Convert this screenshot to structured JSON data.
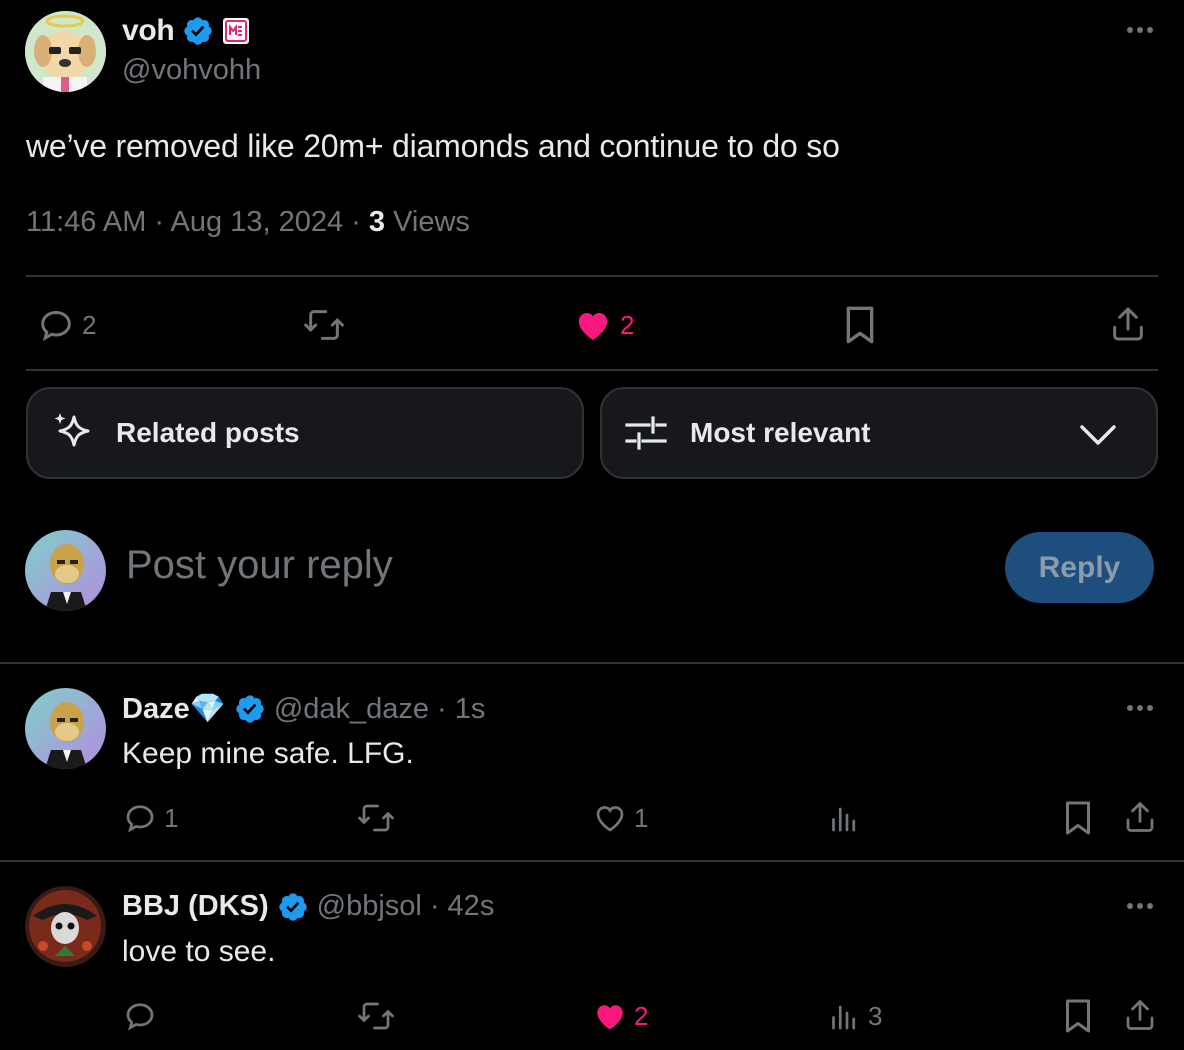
{
  "main_tweet": {
    "author_name": "voh",
    "handle": "@vohvohh",
    "text": "we’ve removed like 20m+ diamonds and continue to do so",
    "time": "11:46 AM · Aug 13, 2024 · ",
    "views_count": "3",
    "views_label": " Views",
    "replies": "2",
    "likes": "2",
    "more_icon": "more-icon"
  },
  "controls": {
    "related_label": "Related posts",
    "sort_label": "Most relevant"
  },
  "composer": {
    "placeholder": "Post your reply",
    "reply_button": "Reply"
  },
  "replies": [
    {
      "author_name": "Daze💎",
      "handle": "@dak_daze",
      "time": "· 1s",
      "text": "Keep mine safe. LFG.",
      "replies": "1",
      "likes": "1",
      "views": "",
      "liked": false
    },
    {
      "author_name": "BBJ (DKS)",
      "handle": "@bbjsol",
      "time": "· 42s",
      "text": "love to see.",
      "replies": "",
      "likes": "2",
      "views": "3",
      "liked": true
    }
  ],
  "colors": {
    "background": "#000000",
    "text": "#e7e9ea",
    "muted": "#71767b",
    "like": "#f91880",
    "verified": "#1d9bf0",
    "border": "#2f3336"
  }
}
